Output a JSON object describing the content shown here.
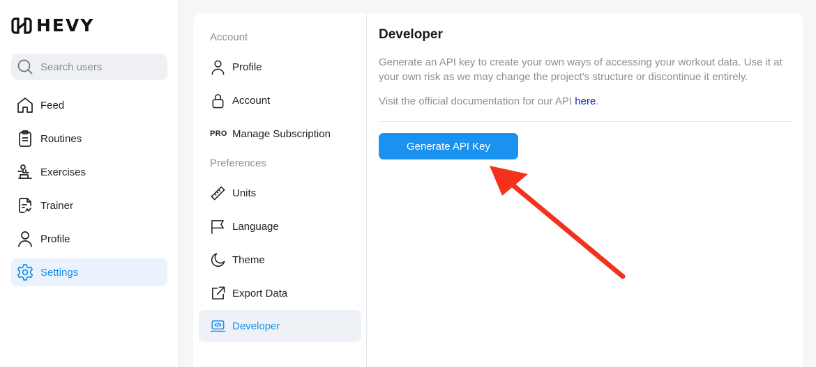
{
  "app": {
    "name": "HEVY"
  },
  "search": {
    "placeholder": "Search users"
  },
  "sidebar": {
    "items": [
      {
        "label": "Feed",
        "icon": "home-icon"
      },
      {
        "label": "Routines",
        "icon": "clipboard-icon"
      },
      {
        "label": "Exercises",
        "icon": "exercise-icon"
      },
      {
        "label": "Trainer",
        "icon": "trainer-doc-icon"
      },
      {
        "label": "Profile",
        "icon": "user-icon"
      },
      {
        "label": "Settings",
        "icon": "gear-icon",
        "active": true
      }
    ]
  },
  "settings": {
    "account_section": "Account",
    "preferences_section": "Preferences",
    "items": [
      {
        "label": "Profile",
        "icon": "user-icon"
      },
      {
        "label": "Account",
        "icon": "lock-icon"
      },
      {
        "label": "Manage Subscription",
        "badge": "PRO"
      },
      {
        "label": "Units",
        "icon": "ruler-icon"
      },
      {
        "label": "Language",
        "icon": "flag-icon"
      },
      {
        "label": "Theme",
        "icon": "moon-icon"
      },
      {
        "label": "Export Data",
        "icon": "external-link-icon"
      },
      {
        "label": "Developer",
        "icon": "code-laptop-icon",
        "active": true
      }
    ]
  },
  "developer": {
    "title": "Developer",
    "description": "Generate an API key to create your own ways of accessing your workout data. Use it at your own risk as we may change the project's structure or discontinue it entirely.",
    "docs_prefix": "Visit the official documentation for our API ",
    "docs_link": "here",
    "docs_suffix": ".",
    "button_label": "Generate API Key"
  },
  "colors": {
    "accent": "#1a93f0",
    "active_text": "#1a8ee8",
    "link": "#0a23c9",
    "arrow": "#f2321c"
  }
}
